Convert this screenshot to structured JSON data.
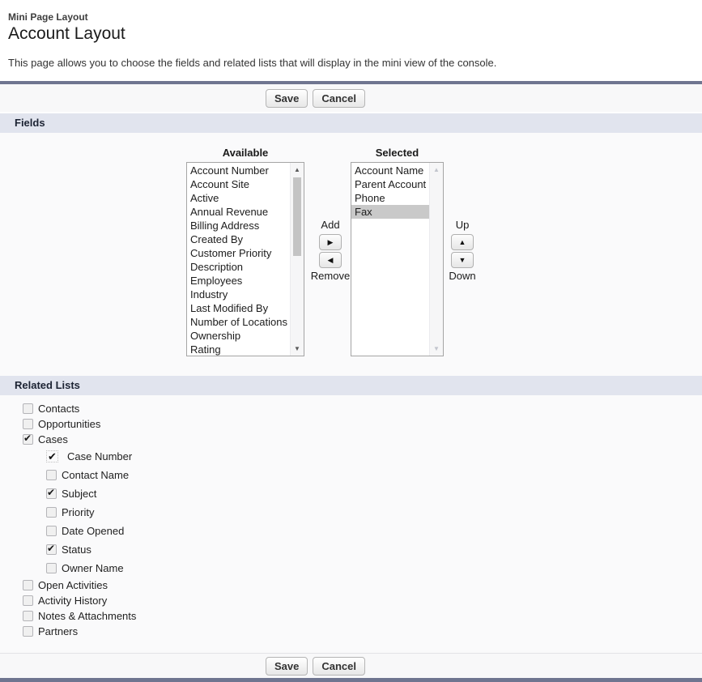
{
  "page": {
    "subtitle": "Mini Page Layout",
    "title": "Account Layout",
    "description": "This page allows you to choose the fields and related lists that will display in the mini view of the console."
  },
  "buttons": {
    "save": "Save",
    "cancel": "Cancel"
  },
  "fields_section": {
    "title": "Fields",
    "available_label": "Available",
    "selected_label": "Selected",
    "add_label": "Add",
    "remove_label": "Remove",
    "up_label": "Up",
    "down_label": "Down",
    "available_items": [
      "Account Number",
      "Account Site",
      "Active",
      "Annual Revenue",
      "Billing Address",
      "Created By",
      "Customer Priority",
      "Description",
      "Employees",
      "Industry",
      "Last Modified By",
      "Number of Locations",
      "Ownership",
      "Rating"
    ],
    "selected_items": [
      "Account Name",
      "Parent Account",
      "Phone",
      "Fax"
    ],
    "highlighted_item": "Fax"
  },
  "related_lists_section": {
    "title": "Related Lists",
    "items": [
      {
        "label": "Contacts",
        "checked": false,
        "level": 0,
        "style": "normal"
      },
      {
        "label": "Opportunities",
        "checked": false,
        "level": 0,
        "style": "normal"
      },
      {
        "label": "Cases",
        "checked": true,
        "level": 0,
        "style": "normal"
      },
      {
        "label": "Case Number",
        "checked": true,
        "level": 1,
        "style": "static-check"
      },
      {
        "label": "Contact Name",
        "checked": false,
        "level": 1,
        "style": "normal"
      },
      {
        "label": "Subject",
        "checked": true,
        "level": 1,
        "style": "normal"
      },
      {
        "label": "Priority",
        "checked": false,
        "level": 1,
        "style": "normal"
      },
      {
        "label": "Date Opened",
        "checked": false,
        "level": 1,
        "style": "normal"
      },
      {
        "label": "Status",
        "checked": true,
        "level": 1,
        "style": "normal"
      },
      {
        "label": "Owner Name",
        "checked": false,
        "level": 1,
        "style": "normal"
      },
      {
        "label": "Open Activities",
        "checked": false,
        "level": 0,
        "style": "normal"
      },
      {
        "label": "Activity History",
        "checked": false,
        "level": 0,
        "style": "normal"
      },
      {
        "label": "Notes & Attachments",
        "checked": false,
        "level": 0,
        "style": "normal"
      },
      {
        "label": "Partners",
        "checked": false,
        "level": 0,
        "style": "normal"
      }
    ]
  },
  "icons": {
    "add_arrow": "right-triangle-icon",
    "remove_arrow": "left-triangle-icon",
    "up_arrow": "up-triangle-icon",
    "down_arrow": "down-triangle-icon"
  },
  "colors": {
    "dark_bar": "#6f7590",
    "section_header_bg": "#e1e4ee",
    "button_bar_bg": "#f8f8f9",
    "list_highlight": "#c9c9c9",
    "body_bg": "#fafafb"
  }
}
